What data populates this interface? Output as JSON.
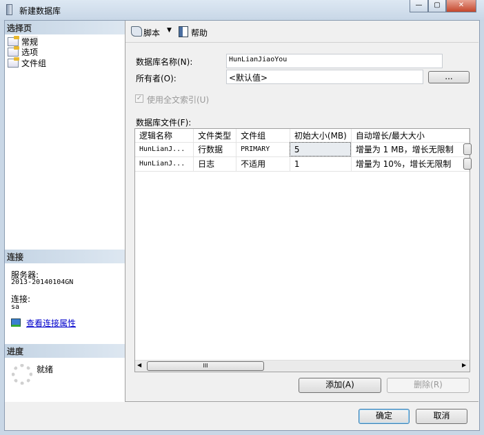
{
  "window": {
    "title": "新建数据库",
    "controls": [
      "—",
      "▢",
      "✕"
    ]
  },
  "left": {
    "select_page_header": "选择页",
    "pages": [
      "常规",
      "选项",
      "文件组"
    ],
    "connection_header": "连接",
    "server_label": "服务器:",
    "server_value": "2013-20140104GN",
    "connection_label": "连接:",
    "connection_value": "sa",
    "view_connection_link": "查看连接属性",
    "progress_header": "进度",
    "progress_status": "就绪"
  },
  "toolbar": {
    "script_label": "脚本",
    "help_label": "帮助"
  },
  "form": {
    "db_name_label": "数据库名称(N):",
    "db_name_value": "HunLianJiaoYou",
    "owner_label": "所有者(O):",
    "owner_value": "<默认值>",
    "owner_browse": "...",
    "fulltext_label": "使用全文索引(U)",
    "fulltext_checked": true,
    "files_label": "数据库文件(F):"
  },
  "grid": {
    "headers": [
      "逻辑名称",
      "文件类型",
      "文件组",
      "初始大小(MB)",
      "自动增长/最大大小"
    ],
    "rows": [
      [
        "HunLianJ...",
        "行数据",
        "PRIMARY",
        "5",
        "增量为 1 MB，增长无限制"
      ],
      [
        "HunLianJ...",
        "日志",
        "不适用",
        "1",
        "增量为 10%，增长无限制"
      ]
    ],
    "scroll_thumb": "III"
  },
  "buttons": {
    "add": "添加(A)",
    "remove": "删除(R)",
    "ok": "确定",
    "cancel": "取消"
  }
}
